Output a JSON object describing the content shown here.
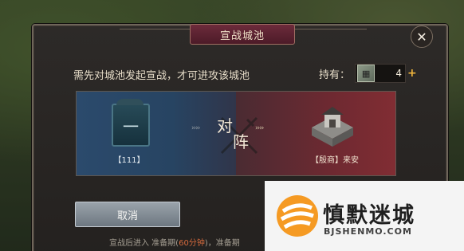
{
  "dialog": {
    "title": "宣战城池",
    "notice": "需先对城池发起宣战，才可进攻该城池",
    "holding_label": "持有：",
    "token_count": "4",
    "left_city": {
      "banner_text": "一",
      "name": "【111】"
    },
    "vs_chars": [
      "对",
      "阵"
    ],
    "arrows": "››››",
    "right_city": {
      "name": "【殷商】来安"
    },
    "cancel_label": "取消",
    "footer_prefix": "宣战后进入 准备期(",
    "footer_highlight": "60分钟",
    "footer_suffix": ")，准备期"
  },
  "watermark": {
    "title": "慎默迷城",
    "url": "BJSHENMO.COM"
  },
  "colors": {
    "left_side": "#274462",
    "right_side": "#6e2931",
    "accent": "#f0b53c",
    "title_bar": "#6d2b3b"
  },
  "icons": [
    "close-icon",
    "token-icon",
    "plus-icon",
    "banner-icon",
    "swords-icon",
    "castle-icon",
    "watermark-logo-icon"
  ]
}
